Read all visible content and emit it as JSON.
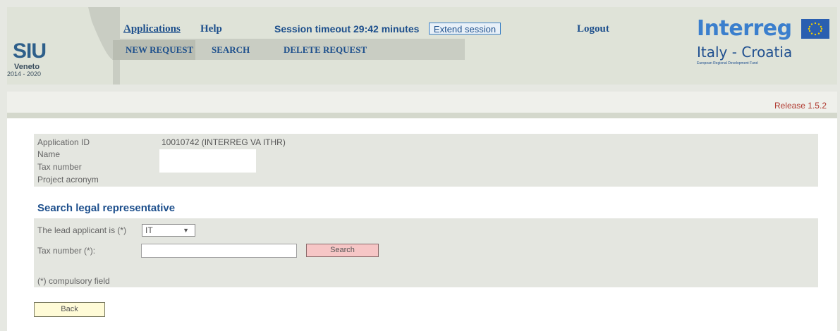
{
  "logo": {
    "name": "SIU",
    "region": "Veneto",
    "years": "2014 - 2020"
  },
  "topnav": {
    "applications": "Applications",
    "help": "Help",
    "logout": "Logout"
  },
  "session": {
    "text": "Session timeout 29:42 minutes",
    "extend_label": "Extend session"
  },
  "subnav": {
    "new_request": "NEW REQUEST",
    "search": "SEARCH",
    "delete_request": "DELETE REQUEST"
  },
  "brand": {
    "name": "Interreg",
    "program": "Italy - Croatia",
    "fund": "European Regional Development Fund"
  },
  "release": "Release 1.5.2",
  "application": {
    "id_label": "Application ID",
    "id_value": "10010742 (INTERREG VA ITHR)",
    "name_label": "Name",
    "tax_label": "Tax number",
    "acronym_label": "Project acronym"
  },
  "search": {
    "title": "Search legal representative",
    "lead_label": "The lead applicant is (*)",
    "lead_value": "IT",
    "tax_label": "Tax number (*):",
    "tax_value": "",
    "button": "Search",
    "note": "(*) compulsory field"
  },
  "back_label": "Back",
  "colors": {
    "accent": "#1d4f8c",
    "search_button": "#f6c6c6",
    "back_button": "#fffbd7",
    "release_text": "#b03a30"
  }
}
